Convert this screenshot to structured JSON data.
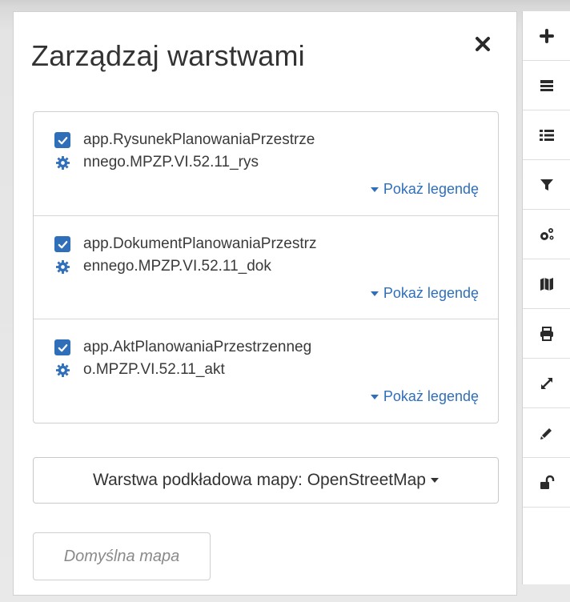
{
  "panel": {
    "title": "Zarządzaj warstwami",
    "close_icon": "close-icon"
  },
  "layers": [
    {
      "name_line1": "app.RysunekPlanowaniaPrzestrze",
      "name_line2": "nnego.MPZP.VI.52.11_rys",
      "checked": true,
      "legend_label": "Pokaż legendę"
    },
    {
      "name_line1": "app.DokumentPlanowaniaPrzestrz",
      "name_line2": "ennego.MPZP.VI.52.11_dok",
      "checked": true,
      "legend_label": "Pokaż legendę"
    },
    {
      "name_line1": "app.AktPlanowaniaPrzestrzenneg",
      "name_line2": "o.MPZP.VI.52.11_akt",
      "checked": true,
      "legend_label": "Pokaż legendę"
    }
  ],
  "basemap": {
    "label": "Warstwa podkładowa mapy: OpenStreetMap"
  },
  "default_map": {
    "label": "Domyślna mapa"
  },
  "toolbar": {
    "items": [
      "plus-icon",
      "layers-icon",
      "list-icon",
      "filter-icon",
      "cogs-icon",
      "map-icon",
      "print-icon",
      "expand-icon",
      "pencil-icon",
      "unlock-icon"
    ]
  },
  "colors": {
    "accent": "#2f6fba",
    "text": "#333333",
    "muted": "#8a8a8a"
  }
}
